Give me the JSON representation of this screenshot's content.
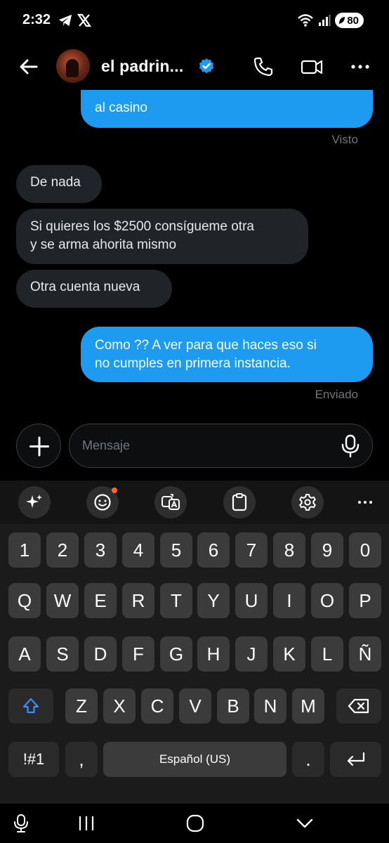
{
  "status_bar": {
    "time": "2:32",
    "battery": "80"
  },
  "header": {
    "contact_name": "el padrin...",
    "accent_color": "#1d9bf0"
  },
  "messages": [
    {
      "direction": "out",
      "text": "al casino"
    },
    {
      "direction": "meta",
      "text": "Visto"
    },
    {
      "direction": "in",
      "text": "De nada"
    },
    {
      "direction": "in",
      "lines": [
        "Si quieres los $2500 consígueme otra",
        "y se arma ahorita mismo"
      ]
    },
    {
      "direction": "in",
      "text": "Otra cuenta nueva"
    },
    {
      "direction": "out",
      "lines": [
        "Como ?? A ver para que haces eso si",
        "no cumples en primera instancia."
      ]
    },
    {
      "direction": "meta",
      "text": "Enviado"
    }
  ],
  "composer": {
    "placeholder": "Mensaje"
  },
  "keyboard": {
    "toolbar_icons": [
      "sparkle-icon",
      "emoji-icon",
      "translate-icon",
      "clipboard-icon",
      "settings-icon",
      "more-icon"
    ],
    "row_numbers": [
      "1",
      "2",
      "3",
      "4",
      "5",
      "6",
      "7",
      "8",
      "9",
      "0"
    ],
    "row_1": [
      "Q",
      "W",
      "E",
      "R",
      "T",
      "Y",
      "U",
      "I",
      "O",
      "P"
    ],
    "row_2": [
      "A",
      "S",
      "D",
      "F",
      "G",
      "H",
      "J",
      "K",
      "L",
      "Ñ"
    ],
    "row_3": [
      "Z",
      "X",
      "C",
      "V",
      "B",
      "N",
      "M"
    ],
    "symbols_key": "!#1",
    "comma_key": ",",
    "space_label": "Español (US)",
    "period_key": "."
  }
}
